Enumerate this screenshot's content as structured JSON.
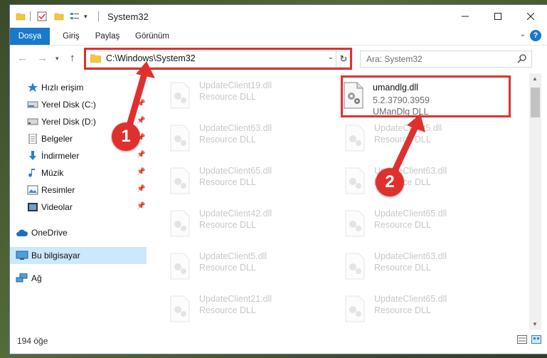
{
  "window": {
    "title": "System32",
    "min_icon": "minimize-icon",
    "max_icon": "maximize-icon",
    "close_icon": "close-icon"
  },
  "ribbon": {
    "tabs": [
      "Dosya",
      "Giriş",
      "Paylaş",
      "Görünüm"
    ]
  },
  "nav": {
    "address": "C:\\Windows\\System32",
    "search_placeholder": "Ara: System32"
  },
  "sidebar": {
    "items": [
      {
        "label": "Hızlı erişim",
        "icon": "star-icon",
        "pinned": false
      },
      {
        "label": "Yerel Disk (C:)",
        "icon": "drive-icon",
        "pinned": true
      },
      {
        "label": "Yerel Disk (D:)",
        "icon": "drive-icon",
        "pinned": true
      },
      {
        "label": "Belgeler",
        "icon": "document-icon",
        "pinned": true
      },
      {
        "label": "İndirmeler",
        "icon": "download-icon",
        "pinned": true
      },
      {
        "label": "Müzik",
        "icon": "music-icon",
        "pinned": true
      },
      {
        "label": "Resimler",
        "icon": "pictures-icon",
        "pinned": true
      },
      {
        "label": "Videolar",
        "icon": "video-icon",
        "pinned": true
      },
      {
        "label": "OneDrive",
        "icon": "cloud-icon",
        "pinned": false
      },
      {
        "label": "Bu bilgisayar",
        "icon": "computer-icon",
        "pinned": false
      },
      {
        "label": "Ağ",
        "icon": "network-icon",
        "pinned": false
      }
    ]
  },
  "files": {
    "left_column": [
      {
        "name": "UpdateClient19.dll",
        "type": "Resource DLL"
      },
      {
        "name": "UpdateClient63.dll",
        "type": "Resource DLL"
      },
      {
        "name": "UpdateClient65.dll",
        "type": "Resource DLL"
      },
      {
        "name": "UpdateClient42.dll",
        "type": "Resource DLL"
      },
      {
        "name": "UpdateClient5.dll",
        "type": "Resource DLL"
      },
      {
        "name": "UpdateClient21.dll",
        "type": "Resource DLL"
      }
    ],
    "highlighted": {
      "name": "umandlg.dll",
      "version": "5.2.3790.3959",
      "description": "UManDlg DLL"
    },
    "right_column": [
      {
        "name": "UpdateClient5.dll",
        "type": "Resource DLL"
      },
      {
        "name": "UpdateClient63.dll",
        "type": "Resource DLL"
      },
      {
        "name": "UpdateClient65.dll",
        "type": "Resource DLL"
      },
      {
        "name": "UpdateClient63.dll",
        "type": "Resource DLL"
      },
      {
        "name": "UpdateClient65.dll",
        "type": "Resource DLL"
      }
    ]
  },
  "status": {
    "count": "194 öğe"
  },
  "annotations": {
    "step1": "1",
    "step2": "2",
    "color": "#e0302e"
  }
}
